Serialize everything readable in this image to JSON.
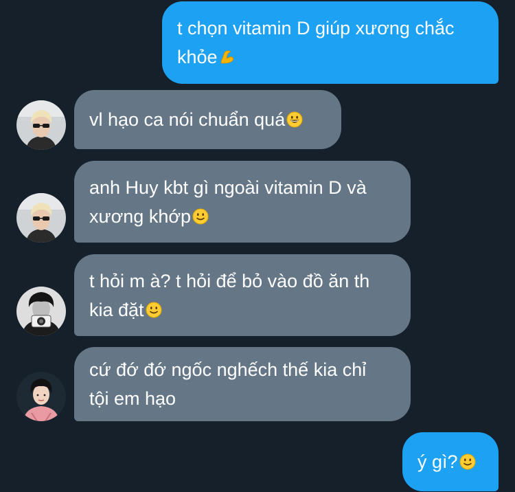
{
  "messages": [
    {
      "id": "m1",
      "direction": "sent",
      "lines": [
        "t chọn vitamin D giúp xương chắc",
        "khỏe"
      ],
      "emoji": "flexed-biceps"
    },
    {
      "id": "m2",
      "direction": "received",
      "avatar": "avatar-blonde-sunglasses",
      "lines": [
        "vl hạo ca nói chuẩn quá"
      ],
      "emoji": "grinning-face"
    },
    {
      "id": "m3",
      "direction": "received",
      "avatar": "avatar-blonde-sunglasses",
      "lines": [
        "anh Huy kbt gì ngoài vitamin D và",
        "xương khớp"
      ],
      "emoji": "slightly-smiling-face"
    },
    {
      "id": "m4",
      "direction": "received",
      "avatar": "avatar-camera-bw",
      "lines": [
        "t hỏi m à? t hỏi để bỏ vào đồ ăn th",
        "kia đặt"
      ],
      "emoji": "slightly-smiling-face"
    },
    {
      "id": "m5",
      "direction": "received",
      "avatar": "avatar-pink-shirt",
      "lines": [
        "cứ đớ đớ ngốc nghếch thế kia chỉ",
        "tội em hạo"
      ],
      "emoji": ""
    },
    {
      "id": "m6",
      "direction": "sent",
      "lines": [
        "ý gì?"
      ],
      "emoji": "slightly-smiling-face"
    }
  ],
  "colors": {
    "background": "#15202b",
    "sent_bubble": "#1da1f2",
    "received_bubble": "#657786",
    "text": "#ffffff"
  }
}
